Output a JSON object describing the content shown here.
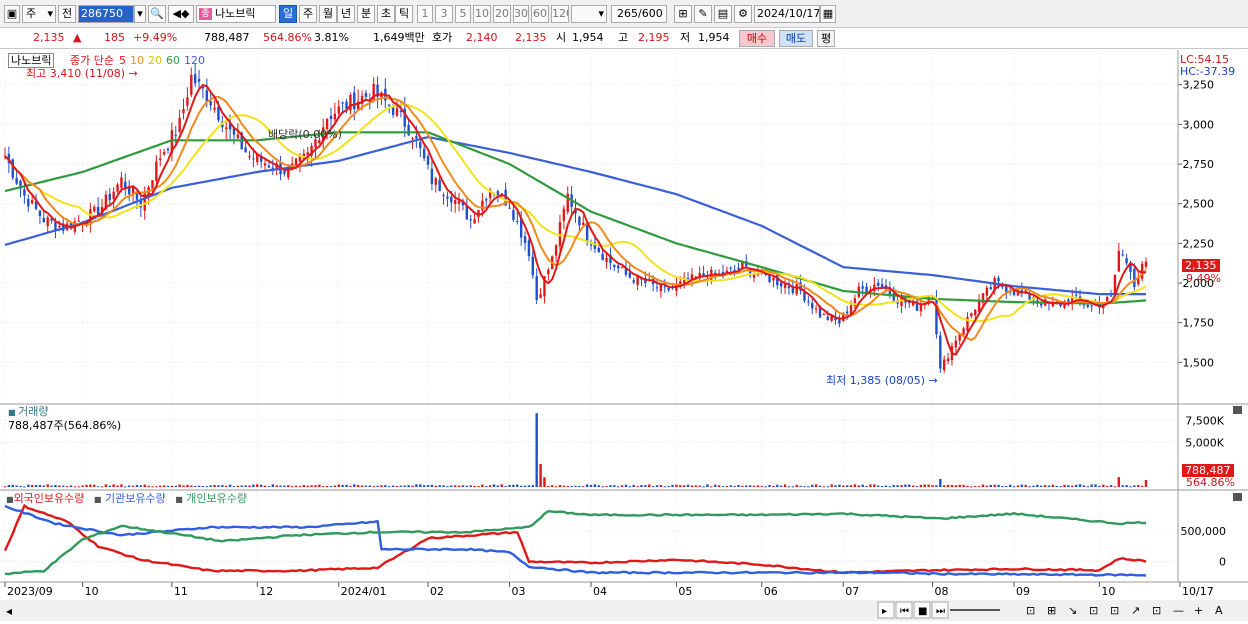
{
  "toolbar": {
    "market_select": "주",
    "prev_label": "전",
    "code": "286750",
    "stock_name": "나노브릭",
    "badge": "종",
    "periods": [
      "일",
      "주",
      "월",
      "년",
      "분",
      "초",
      "틱"
    ],
    "active_period": "일",
    "intervals": [
      "1",
      "3",
      "5",
      "10",
      "20",
      "30",
      "60",
      "120"
    ],
    "count": "265",
    "count_max": "/600",
    "date": "2024/10/17"
  },
  "quote": {
    "price": "2,135",
    "change_arrow": "▲",
    "change": "185",
    "change_pct": "+9.49%",
    "volume": "788,487",
    "volume_ratio": "564.86%",
    "turnover": "3.81%",
    "amount": "1,649백만",
    "hoga_label": "호가",
    "ask": "2,140",
    "bid": "2,135",
    "open_label": "시",
    "open": "1,954",
    "high_label": "고",
    "high": "2,195",
    "low_label": "저",
    "low": "1,954",
    "buy_label": "매수",
    "sell_label": "매도",
    "eval_label": "평"
  },
  "price_panel": {
    "name_tag": "나노브릭",
    "ma_label": "종가 단순",
    "ma_periods": [
      "5",
      "10",
      "20",
      "60",
      "120"
    ],
    "max_annotation": "최고 3,410 (11/08)",
    "min_annotation": "최저 1,385 (08/05)",
    "ex_rights": "배당락(0.00%)",
    "lc": "LC:54.15",
    "hc": "HC:-37.39",
    "current_price_tag": "2,135",
    "current_pct_tag": "9.49%"
  },
  "volume_panel": {
    "title": "거래량",
    "value": "788,487주(564.86%)",
    "tag_value": "788,487",
    "tag_pct": "564.86%"
  },
  "holdings_panel": {
    "series_labels": [
      "외국인보유수량",
      "기관보유수량",
      "개인보유수량"
    ]
  },
  "colors": {
    "ma5": "#e01818",
    "ma10": "#f08a1c",
    "ma20": "#f2e21a",
    "ma60": "#2f9a3c",
    "ma120": "#3a5fd8",
    "up": "#e01818",
    "down": "#1f4fd0",
    "foreign": "#e01818",
    "institution": "#2f5fe0",
    "individual": "#2f9a5c"
  },
  "chart_data": [
    {
      "type": "line",
      "panel": "price",
      "ylim": [
        1250,
        3450
      ],
      "yticks": [
        1500,
        1750,
        2000,
        2250,
        2500,
        2750,
        3000,
        3250
      ],
      "ytick_labels": [
        "1,500",
        "1,750",
        "2,000",
        "2,250",
        "2,500",
        "2,750",
        "3,000",
        "3,250"
      ],
      "x_labels": [
        "2023/09",
        "10",
        "11",
        "12",
        "2024/01",
        "02",
        "03",
        "04",
        "05",
        "06",
        "07",
        "08",
        "09",
        "10",
        "10/17"
      ],
      "x_months": [
        "2023-09",
        "2023-10",
        "2023-11",
        "2023-12",
        "2024-01",
        "2024-02",
        "2024-03",
        "2024-04",
        "2024-05",
        "2024-06",
        "2024-07",
        "2024-08",
        "2024-09",
        "2024-10"
      ],
      "close_anchors": [
        [
          "2023-09-01",
          2800
        ],
        [
          "2023-09-08",
          2550
        ],
        [
          "2023-09-15",
          2400
        ],
        [
          "2023-09-22",
          2350
        ],
        [
          "2023-10-05",
          2450
        ],
        [
          "2023-10-13",
          2650
        ],
        [
          "2023-10-20",
          2500
        ],
        [
          "2023-10-27",
          2800
        ],
        [
          "2023-11-03",
          3000
        ],
        [
          "2023-11-08",
          3300
        ],
        [
          "2023-11-15",
          3150
        ],
        [
          "2023-11-22",
          2950
        ],
        [
          "2023-11-29",
          2800
        ],
        [
          "2023-12-06",
          2750
        ],
        [
          "2023-12-13",
          2700
        ],
        [
          "2023-12-20",
          2800
        ],
        [
          "2023-12-27",
          3050
        ],
        [
          "2024-01-05",
          3150
        ],
        [
          "2024-01-12",
          3200
        ],
        [
          "2024-01-19",
          3100
        ],
        [
          "2024-01-26",
          2950
        ],
        [
          "2024-02-02",
          2650
        ],
        [
          "2024-02-09",
          2550
        ],
        [
          "2024-02-16",
          2400
        ],
        [
          "2024-02-23",
          2600
        ],
        [
          "2024-03-01",
          2500
        ],
        [
          "2024-03-08",
          2200
        ],
        [
          "2024-03-12",
          1900
        ],
        [
          "2024-03-18",
          2150
        ],
        [
          "2024-03-22",
          2550
        ],
        [
          "2024-03-29",
          2300
        ],
        [
          "2024-04-05",
          2150
        ],
        [
          "2024-04-12",
          2050
        ],
        [
          "2024-04-19",
          2000
        ],
        [
          "2024-04-26",
          1950
        ],
        [
          "2024-05-03",
          2000
        ],
        [
          "2024-05-10",
          2050
        ],
        [
          "2024-05-17",
          2050
        ],
        [
          "2024-05-24",
          2100
        ],
        [
          "2024-05-31",
          2050
        ],
        [
          "2024-06-07",
          2000
        ],
        [
          "2024-06-14",
          1950
        ],
        [
          "2024-06-21",
          1800
        ],
        [
          "2024-06-28",
          1750
        ],
        [
          "2024-07-05",
          1950
        ],
        [
          "2024-07-12",
          2000
        ],
        [
          "2024-07-19",
          1900
        ],
        [
          "2024-07-26",
          1850
        ],
        [
          "2024-08-01",
          1950
        ],
        [
          "2024-08-05",
          1450
        ],
        [
          "2024-08-09",
          1650
        ],
        [
          "2024-08-16",
          1850
        ],
        [
          "2024-08-23",
          2000
        ],
        [
          "2024-08-30",
          1950
        ],
        [
          "2024-09-06",
          1900
        ],
        [
          "2024-09-13",
          1850
        ],
        [
          "2024-09-20",
          1900
        ],
        [
          "2024-09-27",
          1850
        ],
        [
          "2024-10-04",
          1900
        ],
        [
          "2024-10-08",
          2200
        ],
        [
          "2024-10-11",
          2100
        ],
        [
          "2024-10-14",
          2000
        ],
        [
          "2024-10-17",
          2135
        ]
      ],
      "ma60_anchors": [
        [
          "2023-09-01",
          2580
        ],
        [
          "2023-10-01",
          2700
        ],
        [
          "2023-11-01",
          2900
        ],
        [
          "2023-12-01",
          2900
        ],
        [
          "2024-01-01",
          2950
        ],
        [
          "2024-02-01",
          2950
        ],
        [
          "2024-03-01",
          2750
        ],
        [
          "2024-04-01",
          2450
        ],
        [
          "2024-05-01",
          2250
        ],
        [
          "2024-06-01",
          2100
        ],
        [
          "2024-07-01",
          1950
        ],
        [
          "2024-08-01",
          1900
        ],
        [
          "2024-09-01",
          1880
        ],
        [
          "2024-10-01",
          1870
        ],
        [
          "2024-10-17",
          1890
        ]
      ],
      "ma120_anchors": [
        [
          "2023-09-01",
          2240
        ],
        [
          "2023-10-01",
          2380
        ],
        [
          "2023-11-01",
          2600
        ],
        [
          "2023-12-01",
          2700
        ],
        [
          "2024-01-01",
          2770
        ],
        [
          "2024-02-01",
          2920
        ],
        [
          "2024-03-01",
          2820
        ],
        [
          "2024-04-01",
          2700
        ],
        [
          "2024-05-01",
          2560
        ],
        [
          "2024-06-01",
          2360
        ],
        [
          "2024-07-01",
          2100
        ],
        [
          "2024-08-01",
          2050
        ],
        [
          "2024-09-01",
          1980
        ],
        [
          "2024-10-01",
          1930
        ],
        [
          "2024-10-17",
          1930
        ]
      ],
      "max": {
        "value": 3410,
        "date": "2023-11-08"
      },
      "min": {
        "value": 1385,
        "date": "2024-08-05"
      },
      "last": {
        "value": 2135,
        "date": "2024-10-17"
      }
    },
    {
      "type": "bar",
      "panel": "volume",
      "ylim": [
        0,
        9000000
      ],
      "yticks": [
        5000000,
        7500000
      ],
      "ytick_labels": [
        "5,000K",
        "7,500K"
      ],
      "baseline_volume": 170000,
      "spikes": [
        [
          "2024-03-12",
          8300000
        ],
        [
          "2024-03-13",
          2600000
        ],
        [
          "2024-03-14",
          1100000
        ],
        [
          "2024-08-05",
          900000
        ],
        [
          "2024-10-08",
          1100000
        ],
        [
          "2024-10-17",
          788487
        ]
      ]
    },
    {
      "type": "line",
      "panel": "holdings",
      "ylim": [
        -300000,
        1100000
      ],
      "yticks": [
        0,
        500000
      ],
      "ytick_labels": [
        "0",
        "500,000"
      ],
      "series": [
        {
          "name": "외국인보유수량",
          "anchors": [
            [
              "2023-09-01",
              180000
            ],
            [
              "2023-09-10",
              900000
            ],
            [
              "2023-09-25",
              650000
            ],
            [
              "2023-10-05",
              250000
            ],
            [
              "2023-10-20",
              30000
            ],
            [
              "2023-11-15",
              -150000
            ],
            [
              "2023-12-15",
              -150000
            ],
            [
              "2024-01-15",
              -100000
            ],
            [
              "2024-02-01",
              380000
            ],
            [
              "2024-03-05",
              480000
            ],
            [
              "2024-03-08",
              0
            ],
            [
              "2024-04-01",
              -20000
            ],
            [
              "2024-05-01",
              30000
            ],
            [
              "2024-06-01",
              -50000
            ],
            [
              "2024-07-01",
              -180000
            ],
            [
              "2024-08-01",
              -140000
            ],
            [
              "2024-09-01",
              -120000
            ],
            [
              "2024-10-01",
              -140000
            ],
            [
              "2024-10-08",
              50000
            ],
            [
              "2024-10-17",
              10000
            ]
          ]
        },
        {
          "name": "기관보유수량",
          "anchors": [
            [
              "2023-09-01",
              900000
            ],
            [
              "2023-09-20",
              620000
            ],
            [
              "2023-10-15",
              430000
            ],
            [
              "2023-11-15",
              560000
            ],
            [
              "2023-12-20",
              560000
            ],
            [
              "2024-01-15",
              650000
            ],
            [
              "2024-01-16",
              200000
            ],
            [
              "2024-02-15",
              200000
            ],
            [
              "2024-03-01",
              150000
            ],
            [
              "2024-03-10",
              -80000
            ],
            [
              "2024-04-01",
              -180000
            ],
            [
              "2024-06-01",
              -180000
            ],
            [
              "2024-07-15",
              -180000
            ],
            [
              "2024-08-05",
              -200000
            ],
            [
              "2024-10-17",
              -220000
            ]
          ]
        },
        {
          "name": "개인보유수량",
          "anchors": [
            [
              "2023-09-01",
              -200000
            ],
            [
              "2023-09-15",
              -150000
            ],
            [
              "2023-10-01",
              360000
            ],
            [
              "2023-10-15",
              580000
            ],
            [
              "2023-11-01",
              460000
            ],
            [
              "2023-11-20",
              330000
            ],
            [
              "2023-12-15",
              430000
            ],
            [
              "2024-01-15",
              480000
            ],
            [
              "2024-02-15",
              480000
            ],
            [
              "2024-03-08",
              560000
            ],
            [
              "2024-03-15",
              820000
            ],
            [
              "2024-04-01",
              760000
            ],
            [
              "2024-06-01",
              760000
            ],
            [
              "2024-07-01",
              780000
            ],
            [
              "2024-08-05",
              700000
            ],
            [
              "2024-09-01",
              780000
            ],
            [
              "2024-10-08",
              620000
            ],
            [
              "2024-10-17",
              640000
            ]
          ]
        }
      ]
    }
  ]
}
